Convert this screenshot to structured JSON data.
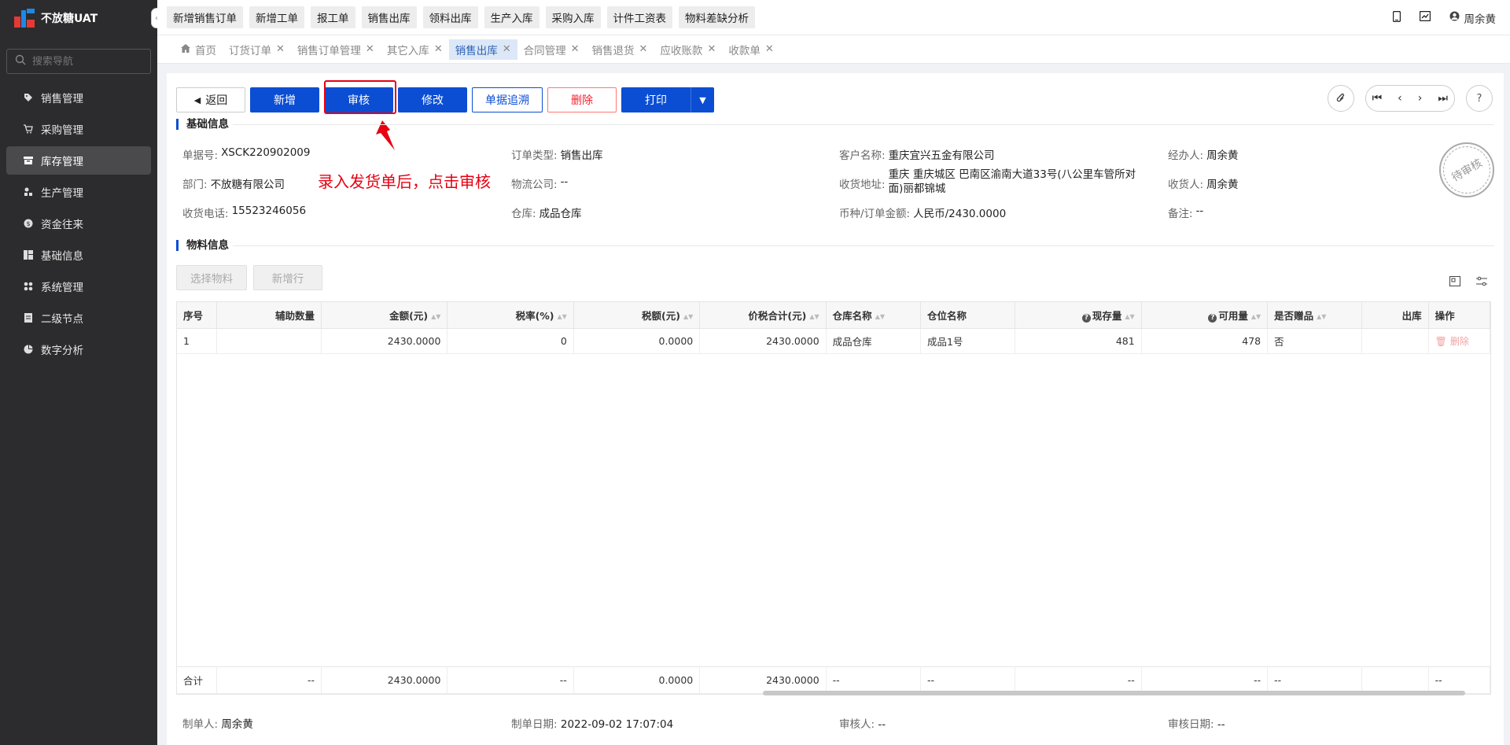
{
  "app": {
    "title": "不放糖UAT"
  },
  "sidebar": {
    "search_placeholder": "搜索导航",
    "items": [
      {
        "label": "销售管理"
      },
      {
        "label": "采购管理"
      },
      {
        "label": "库存管理"
      },
      {
        "label": "生产管理"
      },
      {
        "label": "资金往来"
      },
      {
        "label": "基础信息"
      },
      {
        "label": "系统管理"
      },
      {
        "label": "二级节点"
      },
      {
        "label": "数字分析"
      }
    ]
  },
  "topbar": {
    "quick": [
      "新增销售订单",
      "新增工单",
      "报工单",
      "销售出库",
      "领料出库",
      "生产入库",
      "采购入库",
      "计件工资表",
      "物料差缺分析"
    ],
    "user": "周余黄"
  },
  "tabs": [
    {
      "label": "首页"
    },
    {
      "label": "订货订单"
    },
    {
      "label": "销售订单管理"
    },
    {
      "label": "其它入库"
    },
    {
      "label": "销售出库"
    },
    {
      "label": "合同管理"
    },
    {
      "label": "销售退货"
    },
    {
      "label": "应收账款"
    },
    {
      "label": "收款单"
    }
  ],
  "toolbar": {
    "back": "返回",
    "add": "新增",
    "audit": "审核",
    "edit": "修改",
    "trace": "单据追溯",
    "delete": "删除",
    "print": "打印"
  },
  "annotation": "录入发货单后，点击审核",
  "basic": {
    "title": "基础信息",
    "doc_no_label": "单据号:",
    "doc_no": "XSCK220902009",
    "order_type_label": "订单类型:",
    "order_type": "销售出库",
    "customer_label": "客户名称:",
    "customer": "重庆宜兴五金有限公司",
    "handler_label": "经办人:",
    "handler": "周余黄",
    "dept_label": "部门:",
    "dept": "不放糖有限公司",
    "logistics_label": "物流公司:",
    "logistics": "--",
    "address_label": "收货地址:",
    "address": "重庆 重庆城区 巴南区渝南大道33号(八公里车管所对面)丽都锦城",
    "receiver_label": "收货人:",
    "receiver": "周余黄",
    "phone_label": "收货电话:",
    "phone": "15523246056",
    "warehouse_label": "仓库:",
    "warehouse": "成品仓库",
    "currency_label": "币种/订单金额:",
    "currency": "人民币/2430.0000",
    "remark_label": "备注:",
    "remark": "--",
    "stamp": "待审核"
  },
  "material": {
    "title": "物料信息",
    "select_btn": "选择物料",
    "add_row_btn": "新增行"
  },
  "grid": {
    "headers": [
      "序号",
      "辅助数量",
      "金额(元)",
      "税率(%)",
      "税额(元)",
      "价税合计(元)",
      "仓库名称",
      "仓位名称",
      "现存量",
      "可用量",
      "是否赠品",
      "出库",
      "操作"
    ],
    "row": {
      "no": "1",
      "aux": "",
      "amount": "2430.0000",
      "tax_rate": "0",
      "tax": "0.0000",
      "total": "2430.0000",
      "wh": "成品仓库",
      "loc": "成品1号",
      "stock": "481",
      "avail": "478",
      "gift": "否",
      "out": "",
      "op": "删除"
    },
    "sum": {
      "label": "合计",
      "aux": "--",
      "amount": "2430.0000",
      "tax_rate": "--",
      "tax": "0.0000",
      "total": "2430.0000",
      "wh": "--",
      "loc": "--",
      "stock": "--",
      "avail": "--",
      "gift": "--",
      "op": "--"
    }
  },
  "footer": {
    "creator_label": "制单人:",
    "creator": "周余黄",
    "create_date_label": "制单日期:",
    "create_date": "2022-09-02 17:07:04",
    "auditor_label": "审核人:",
    "auditor": "--",
    "audit_date_label": "审核日期:",
    "audit_date": "--"
  }
}
